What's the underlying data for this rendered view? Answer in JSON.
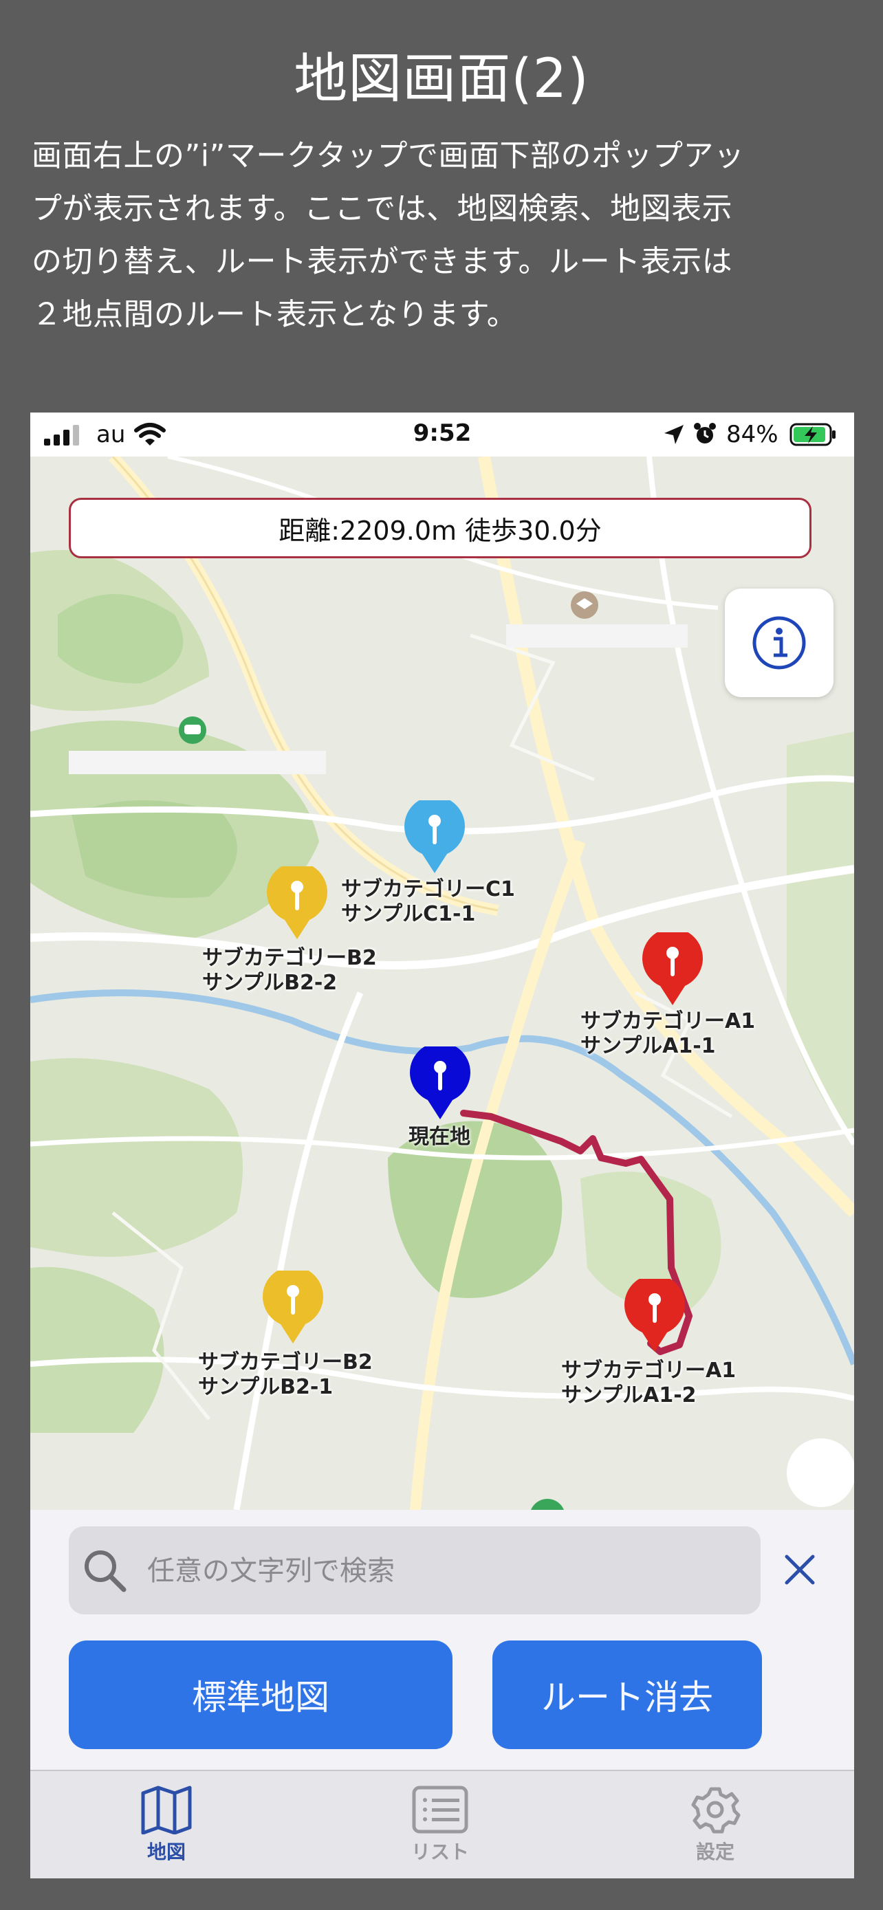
{
  "heading": "地図画面(2)",
  "description": [
    "画面右上の”i”マークタップで画面下部のポップアッ",
    "プが表示されます。ここでは、地図検索、地図表示",
    "の切り替え、ルート表示ができます。ルート表示は",
    "２地点間のルート表示となります。"
  ],
  "status_bar": {
    "carrier": "au",
    "time": "9:52",
    "battery": "84%"
  },
  "map": {
    "distance_text": "距離:2209.0m 徒歩30.0分",
    "current_location_label": "現在地",
    "pins": [
      {
        "category": "サブカテゴリーC1",
        "name": "サンプルC1-1",
        "color": "#45aee6"
      },
      {
        "category": "サブカテゴリーB2",
        "name": "サンプルB2-2",
        "color": "#ecbe2a"
      },
      {
        "category": "サブカテゴリーA1",
        "name": "サンプルA1-1",
        "color": "#e0261f"
      },
      {
        "category": "サブカテゴリーB2",
        "name": "サンプルB2-1",
        "color": "#ecbe2a"
      },
      {
        "category": "サブカテゴリーA1",
        "name": "サンプルA1-2",
        "color": "#e0261f"
      }
    ],
    "current_location_color": "#0a0ad6",
    "route_color": "#b3254a"
  },
  "panel": {
    "search_placeholder": "任意の文字列で検索",
    "standard_map_button": "標準地図",
    "clear_route_button": "ルート消去"
  },
  "tabbar": {
    "map_label": "地図",
    "list_label": "リスト",
    "settings_label": "設定"
  },
  "colors": {
    "accent": "#2f74e6",
    "tab_active": "#2b4ea8",
    "background": "#5c5c5c"
  }
}
